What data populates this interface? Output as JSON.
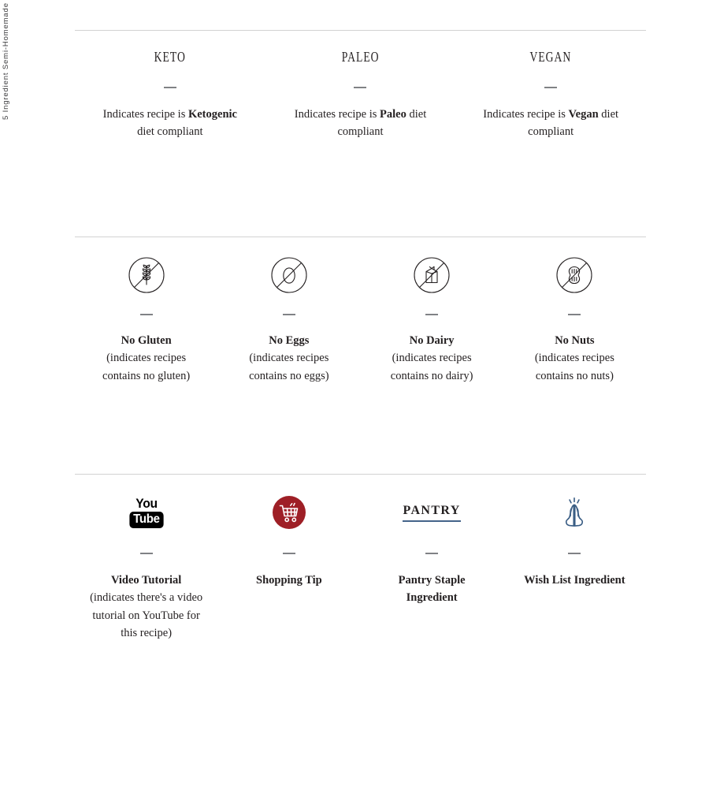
{
  "running_head": "5 Ingredient Semi-Homemade",
  "sections": {
    "diet": {
      "items": [
        {
          "title": "KETO",
          "desc_pre": "Indicates recipe is ",
          "desc_bold": "Ketogenic",
          "desc_post": " diet compliant"
        },
        {
          "title": "PALEO",
          "desc_pre": "Indicates recipe is ",
          "desc_bold": "Paleo",
          "desc_post": " diet compliant"
        },
        {
          "title": "VEGAN",
          "desc_pre": "Indicates recipe is ",
          "desc_bold": "Vegan",
          "desc_post": " diet compliant"
        }
      ]
    },
    "allergens": {
      "items": [
        {
          "icon": "no-gluten-icon",
          "label": "No Gluten",
          "desc": "(indicates recipes contains no gluten)"
        },
        {
          "icon": "no-eggs-icon",
          "label": "No Eggs",
          "desc": "(indicates recipes contains no eggs)"
        },
        {
          "icon": "no-dairy-icon",
          "label": "No Dairy",
          "desc": "(indicates recipes contains no dairy)"
        },
        {
          "icon": "no-nuts-icon",
          "label": "No Nuts",
          "desc": "(indicates recipes contains no nuts)"
        }
      ]
    },
    "extras": {
      "items": [
        {
          "icon": "youtube-icon",
          "icon_text_top": "You",
          "icon_text_bottom": "Tube",
          "label": "Video Tutorial",
          "desc": "(indicates there's a video tutorial on YouTube for this recipe)"
        },
        {
          "icon": "shopping-cart-icon",
          "label": "Shopping Tip",
          "desc": ""
        },
        {
          "icon": "pantry-icon",
          "icon_text": "PANTRY",
          "label": "Pantry Staple Ingredient",
          "desc": ""
        },
        {
          "icon": "praying-hands-icon",
          "label": "Wish List Ingredient",
          "desc": ""
        }
      ]
    }
  },
  "colors": {
    "text": "#231f20",
    "rule": "#d2d2d2",
    "dash": "#808285",
    "cart_red": "#9e1f26",
    "pantry_blue": "#44648a",
    "hands_blue": "#3b5e85"
  }
}
